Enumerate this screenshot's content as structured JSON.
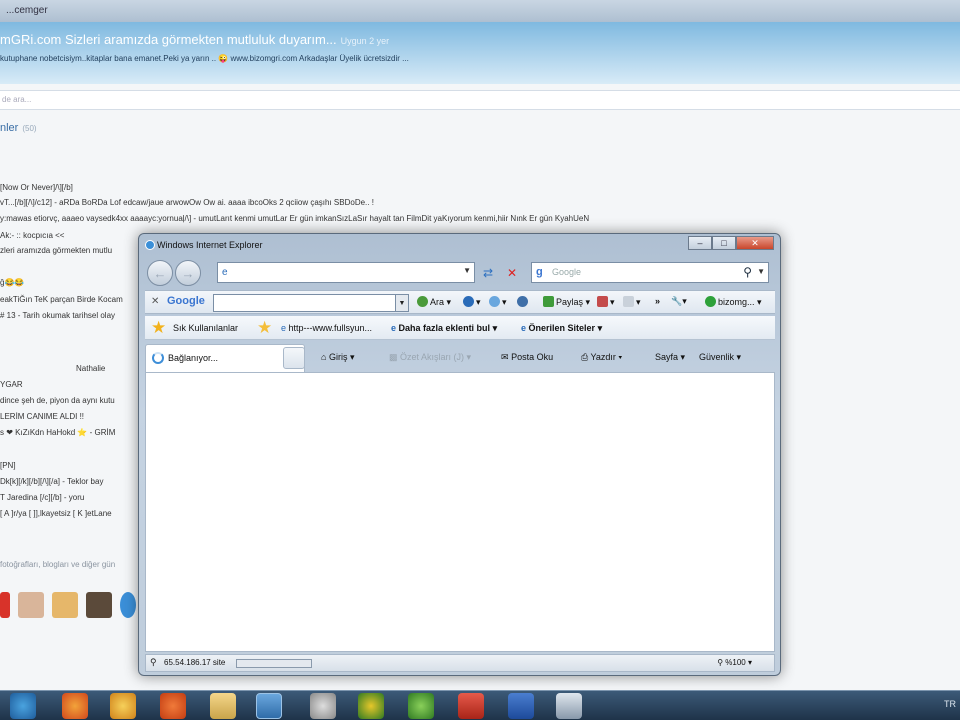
{
  "background": {
    "title_fragment": "...cemger",
    "heading": "mGRi.com Sizleri aramızda görmekten mutluluk duyarım...",
    "heading_when": "Uygun 2 yer",
    "subline": "kutuphane nobetcisiym..kitaplar bana emanet.Peki ya yarın .. 😜 www.bizomgri.com Arkadaşlar Üyelik ücretsizdir ...",
    "search_placeholder": "de ara...",
    "section": "nler",
    "section_count": "(50)",
    "feed": [
      "[Now Or Never]/\\][/b]",
      "vT...[/b][/\\]/c12] - aRDa BoRDa Lof edcaw/jaue arwowOw Ow ai. aaaa ibcoOks 2 qciiow çaşıhı SBDoDe.. !",
      "y:mawas etiorvç, aaaeo vaysedk4xx aaaayc:yornuaļ/\\] - umutLarıt kenmi umutLar Er gün imkanSızLaSır hayalt tan FilmDit yaKıyorum kenmi,hiir Nınk Er gün KyahUeN",
      "zleri aramızda görmekten mutlu",
      "Ak:- :: kocpıcıa <<",
      "ğ😂😂",
      "eakTiĞın TeK parçan Birde Kocam",
      "# 13 - Tarih okumak tarihsel olay",
      "Nathalie",
      "YGAR",
      "dince şeh de, piyon da aynı kutu",
      "LERİM CANIME ALDI !!",
      "s ❤ KıZıKdn HaHokd ⭐ - GRİM",
      "[PN]",
      "Dk[k][/k][/b][/\\][/a] - Teklor bay",
      "T        Jaredina    [/c][/b] - yoru",
      "[ A ]r/ya [ ]],lkayetsiz [ K ]etLane"
    ],
    "footer": "fotoğrafları, blogları ve diğer gün"
  },
  "ie": {
    "title": "Windows Internet Explorer",
    "address_value": "",
    "search_placeholder": "Google",
    "google_logo": "Google",
    "toolbar": {
      "ara": "Ara",
      "paylas": "Paylaş",
      "more": "»",
      "account": "bizomg..."
    },
    "favorites": {
      "sik": "Sık Kullanılanlar",
      "link1": "http---www.fullsyun...",
      "link2": "Daha fazla eklenti bul",
      "link3": "Önerilen Siteler"
    },
    "tab_label": "Bağlanıyor...",
    "commands": {
      "home": "Giriş",
      "feeds": "Özet Akışları (J)",
      "read_mail": "Posta Oku",
      "print": "Yazdır",
      "page": "Sayfa",
      "safety": "Güvenlik"
    },
    "status": {
      "text": "65.54.186.17 site",
      "zoom": "%100"
    }
  },
  "taskbar": {
    "tray": "TR"
  }
}
